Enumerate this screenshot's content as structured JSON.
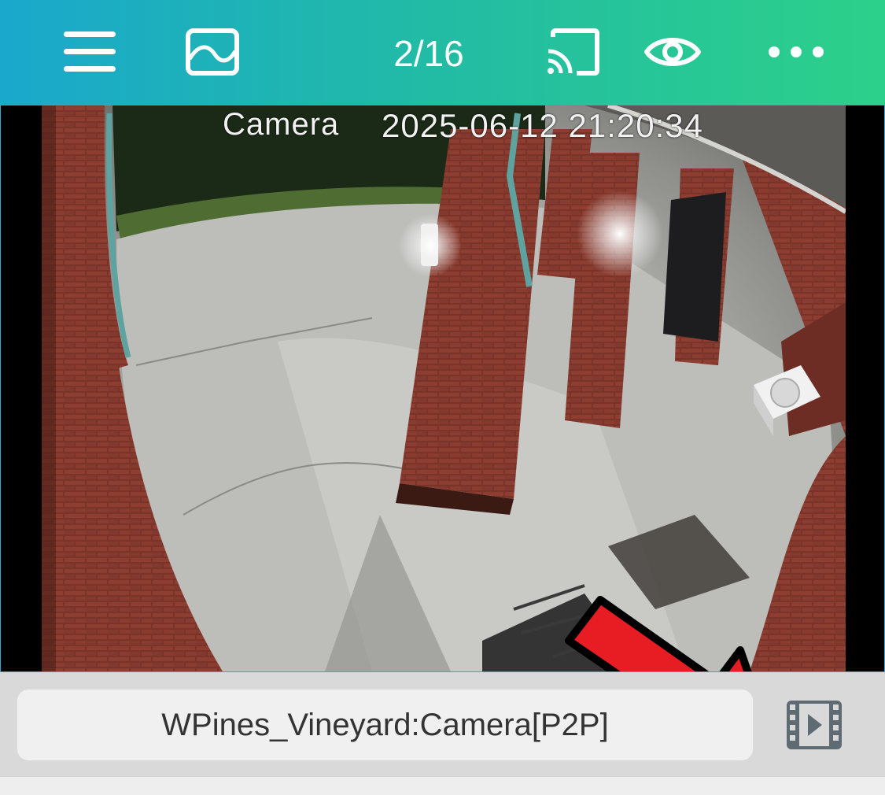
{
  "toolbar": {
    "menu_icon": "hamburger-menu-icon",
    "gallery_icon": "image-icon",
    "counter": "2/16",
    "cast_icon": "cast-icon",
    "view_icon": "eye-icon",
    "more_icon": "more-horizontal-icon"
  },
  "video": {
    "osd_label": "Camera",
    "osd_timestamp": "2025-06-12 21:20:34"
  },
  "bottom": {
    "camera_name": "WPines_Vineyard:Camera[P2P]",
    "clip_icon": "film-play-icon"
  },
  "colors": {
    "header_gradient_start": "#1aa8cc",
    "header_gradient_end": "#2dd08a",
    "arrow": "#e81c23",
    "bottom_bar": "#d9d9d9"
  }
}
